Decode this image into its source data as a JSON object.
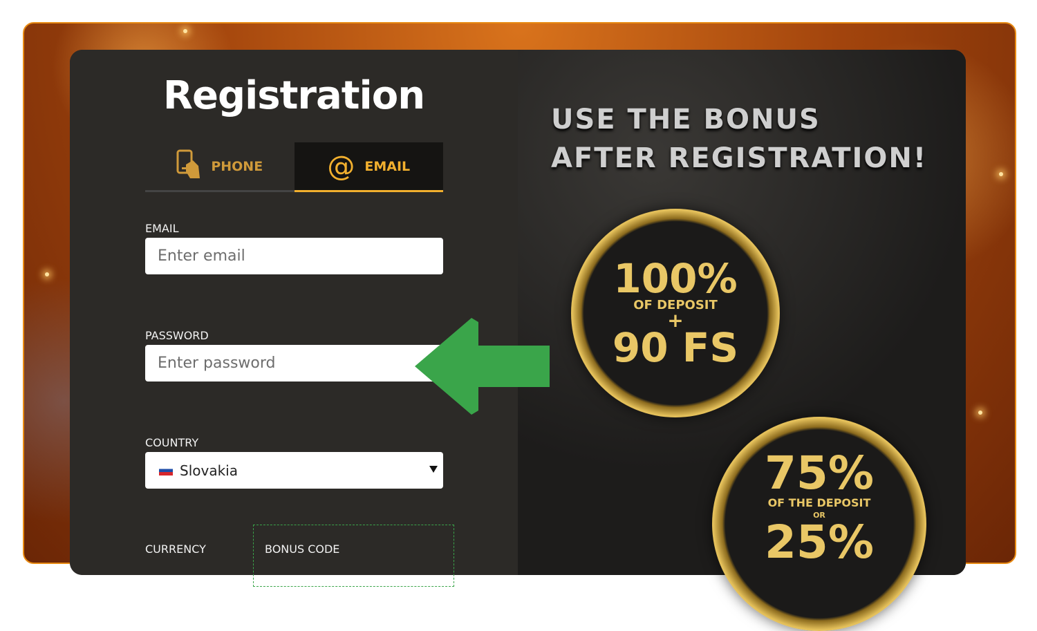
{
  "registration": {
    "title": "Registration",
    "tabs": [
      {
        "label": "PHONE",
        "icon": "phone-icon",
        "active": false
      },
      {
        "label": "EMAIL",
        "icon": "at-icon",
        "active": true
      }
    ],
    "email": {
      "label": "EMAIL",
      "placeholder": "Enter email"
    },
    "password": {
      "label": "PASSWORD",
      "placeholder": "Enter password"
    },
    "country": {
      "label": "COUNTRY",
      "value": "Slovakia",
      "flag": "slovakia-flag-icon"
    },
    "currency": {
      "label": "CURRENCY"
    },
    "bonus_code": {
      "label": "BONUS CODE"
    }
  },
  "promo": {
    "title_line1": "USE THE BONUS",
    "title_line2": "AFTER REGISTRATION!",
    "coin1": {
      "percent": "100%",
      "line": "OF DEPOSIT",
      "plus": "+",
      "fs": "90 FS"
    },
    "coin2": {
      "percent": "75%",
      "line": "OF THE DEPOSIT",
      "or": "OR",
      "partial": "25%"
    }
  },
  "colors": {
    "accent": "#f2b02e",
    "frame": "#e88a12",
    "arrow": "#3aa54a",
    "panel": "#2c2a27"
  }
}
